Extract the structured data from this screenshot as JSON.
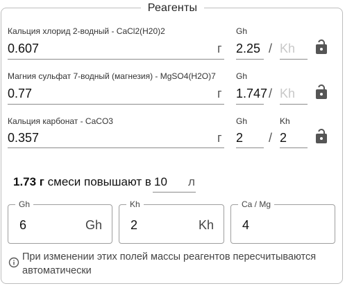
{
  "title": "Реагенты",
  "reagents": [
    {
      "label": "Кальция хлорид 2-водный - CaCl2(H20)2",
      "mass": "0.607",
      "mass_unit": "г",
      "gh_label": "Gh",
      "gh_value": "2.25",
      "kh_label": "",
      "kh_value": "",
      "kh_placeholder": "Kh",
      "separator": "/"
    },
    {
      "label": "Магния сульфат 7-водный (магнезия) - MgSO4(H2O)7",
      "mass": "0.77",
      "mass_unit": "г",
      "gh_label": "Gh",
      "gh_value": "1.747",
      "kh_label": "",
      "kh_value": "",
      "kh_placeholder": "Kh",
      "separator": "/"
    },
    {
      "label": "Кальция карбонат - CaCO3",
      "mass": "0.357",
      "mass_unit": "г",
      "gh_label": "Gh",
      "gh_value": "2",
      "kh_label": "Kh",
      "kh_value": "2",
      "kh_placeholder": "",
      "separator": "/"
    }
  ],
  "mix": {
    "amount": "1.73 г",
    "text": "смеси повышают в",
    "volume": "10",
    "volume_unit": "л"
  },
  "results": {
    "gh": {
      "label": "Gh",
      "value": "6",
      "unit": "Gh"
    },
    "kh": {
      "label": "Kh",
      "value": "2",
      "unit": "Kh"
    },
    "ca_mg": {
      "label": "Ca / Mg",
      "value": "4"
    }
  },
  "info": {
    "icon": "info-icon",
    "text": "При изменении этих полей массы реагентов пересчитываются автоматически"
  },
  "colors": {
    "lock": "#555555",
    "border": "#bdbdbd",
    "placeholder": "#c8c8c8"
  }
}
